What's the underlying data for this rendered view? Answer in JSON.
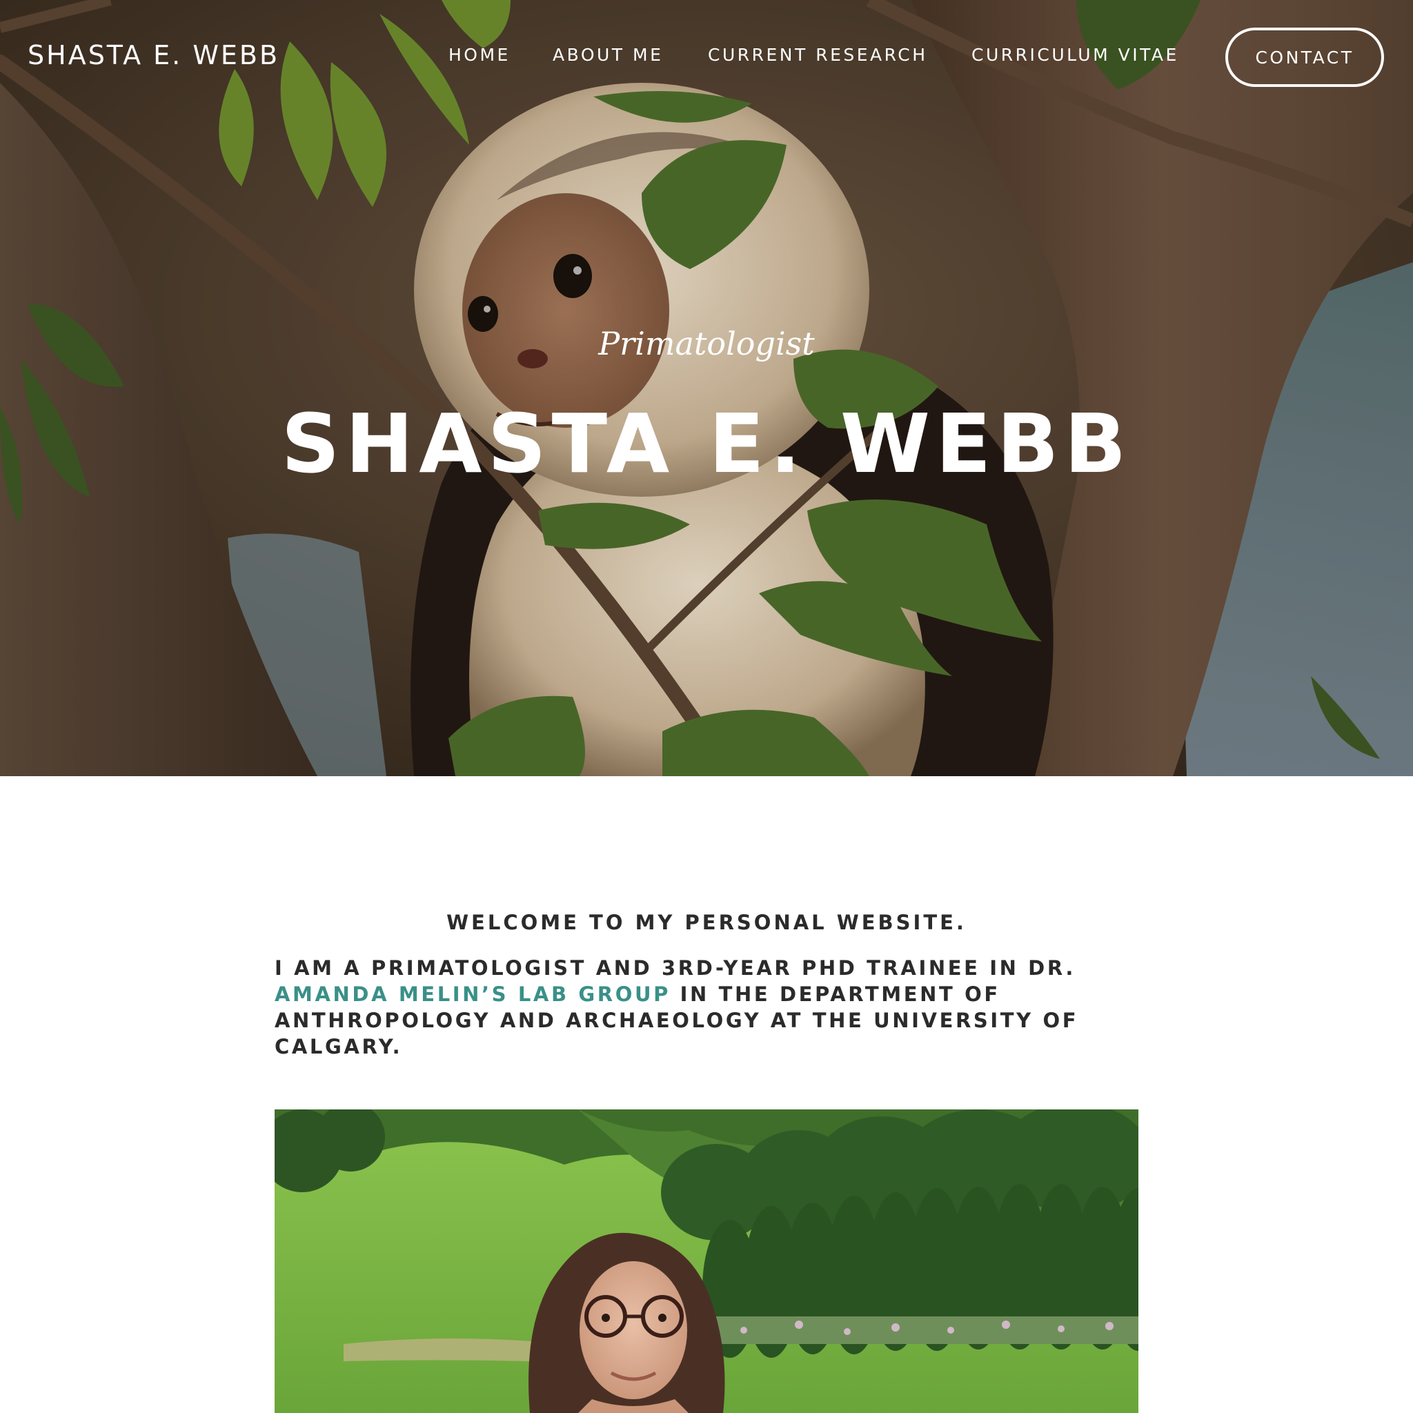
{
  "header": {
    "site_title": "SHASTA E. WEBB",
    "nav": {
      "home": "HOME",
      "about": "ABOUT ME",
      "research": "CURRENT RESEARCH",
      "cv": "CURRICULUM VITAE"
    },
    "contact_label": "CONTACT"
  },
  "hero": {
    "subtitle": "Primatologist",
    "title": "SHASTA E. WEBB",
    "image": "capuchin-monkey-in-tree"
  },
  "content": {
    "welcome": "WELCOME TO MY PERSONAL WEBSITE.",
    "intro_before": "I AM A PRIMATOLOGIST AND 3RD-YEAR PHD TRAINEE IN DR. ",
    "intro_link": "AMANDA MELIN’S LAB GROUP",
    "intro_after": " IN THE DEPARTMENT OF ANTHROPOLOGY AND ARCHAEOLOGY AT THE UNIVERSITY OF CALGARY.",
    "portrait_image": "portrait-outdoors-green-hills"
  },
  "colors": {
    "link": "#3a9088",
    "text": "#2b2b2b",
    "nav_text": "#ffffff"
  }
}
